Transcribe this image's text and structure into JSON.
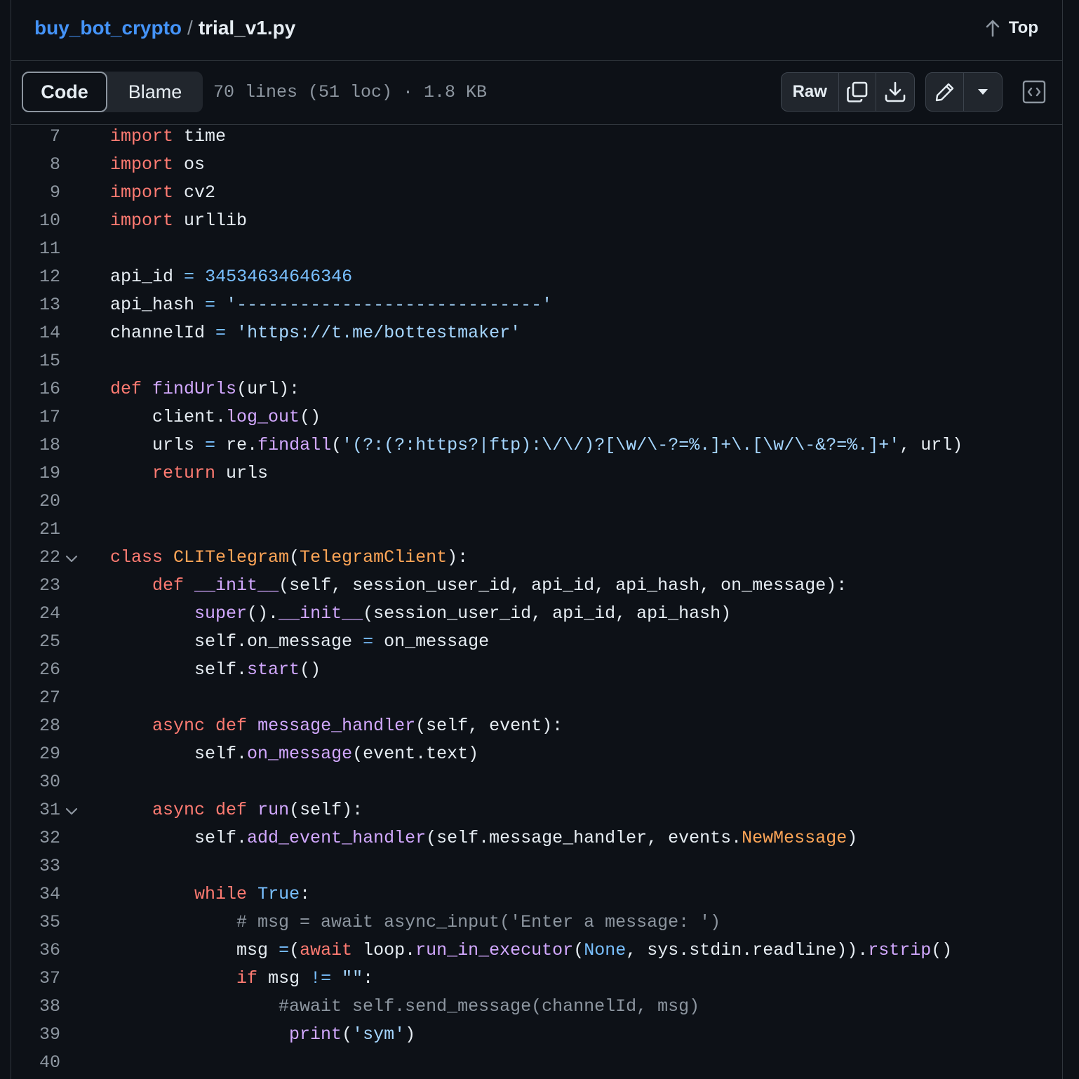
{
  "header": {
    "repo": "buy_bot_crypto",
    "separator": "/",
    "file": "trial_v1.py",
    "top_label": "Top"
  },
  "toolbar": {
    "code_tab": "Code",
    "blame_tab": "Blame",
    "file_meta": "70 lines (51 loc) · 1.8 KB",
    "raw_label": "Raw"
  },
  "lines": [
    {
      "n": "7",
      "fold": false,
      "tokens": [
        [
          "kw",
          "import"
        ],
        [
          "",
          "time"
        ]
      ]
    },
    {
      "n": "8",
      "fold": false,
      "tokens": [
        [
          "kw",
          "import"
        ],
        [
          "",
          "os"
        ]
      ]
    },
    {
      "n": "9",
      "fold": false,
      "tokens": [
        [
          "kw",
          "import"
        ],
        [
          "",
          "cv2"
        ]
      ]
    },
    {
      "n": "10",
      "fold": false,
      "tokens": [
        [
          "kw",
          "import"
        ],
        [
          "",
          "urllib"
        ]
      ]
    },
    {
      "n": "11",
      "fold": false,
      "tokens": []
    },
    {
      "n": "12",
      "fold": false,
      "tokens": [
        [
          "",
          "api_id"
        ],
        [
          "op",
          "="
        ],
        [
          "num",
          "34534634646346"
        ]
      ]
    },
    {
      "n": "13",
      "fold": false,
      "tokens": [
        [
          "",
          "api_hash"
        ],
        [
          "op",
          "="
        ],
        [
          "str",
          "'-----------------------------'"
        ]
      ]
    },
    {
      "n": "14",
      "fold": false,
      "tokens": [
        [
          "",
          "channelId"
        ],
        [
          "op",
          "="
        ],
        [
          "str",
          "'https://t.me/bottestmaker'"
        ]
      ]
    },
    {
      "n": "15",
      "fold": false,
      "tokens": []
    },
    {
      "n": "16",
      "fold": false,
      "tokens": [
        [
          "kw",
          "def"
        ],
        [
          "fn",
          "findUrls"
        ],
        [
          "",
          "(url):"
        ]
      ]
    },
    {
      "n": "17",
      "fold": false,
      "tokens": [
        [
          "",
          "    client."
        ],
        [
          "fn",
          "log_out"
        ],
        [
          "",
          "()"
        ]
      ]
    },
    {
      "n": "18",
      "fold": false,
      "tokens": [
        [
          "",
          "    urls"
        ],
        [
          "op",
          "="
        ],
        [
          "",
          "re."
        ],
        [
          "fn",
          "findall"
        ],
        [
          "",
          "("
        ],
        [
          "str",
          "'(?:(?:https?|ftp):\\/\\/)?[\\w/\\-?=%.]+\\.[\\w/\\-&?=%.]+'"
        ],
        [
          "",
          ", url)"
        ]
      ]
    },
    {
      "n": "19",
      "fold": false,
      "tokens": [
        [
          "kw",
          "    return"
        ],
        [
          "",
          "urls"
        ]
      ]
    },
    {
      "n": "20",
      "fold": false,
      "tokens": []
    },
    {
      "n": "21",
      "fold": false,
      "tokens": []
    },
    {
      "n": "22",
      "fold": true,
      "tokens": [
        [
          "kw",
          "class"
        ],
        [
          "cls",
          "CLITelegram"
        ],
        [
          "",
          "("
        ],
        [
          "cls",
          "TelegramClient"
        ],
        [
          "",
          "):"
        ]
      ]
    },
    {
      "n": "23",
      "fold": false,
      "tokens": [
        [
          "kw",
          "    def"
        ],
        [
          "fn",
          "__init__"
        ],
        [
          "",
          "(self, session_user_id, api_id, api_hash, on_message):"
        ]
      ]
    },
    {
      "n": "24",
      "fold": false,
      "tokens": [
        [
          "fn",
          "        super"
        ],
        [
          "",
          "()."
        ],
        [
          "fn",
          "__init__"
        ],
        [
          "",
          "(session_user_id, api_id, api_hash)"
        ]
      ]
    },
    {
      "n": "25",
      "fold": false,
      "tokens": [
        [
          "",
          "        self.on_message"
        ],
        [
          "op",
          "="
        ],
        [
          "",
          "on_message"
        ]
      ]
    },
    {
      "n": "26",
      "fold": false,
      "tokens": [
        [
          "",
          "        self."
        ],
        [
          "fn",
          "start"
        ],
        [
          "",
          "()"
        ]
      ]
    },
    {
      "n": "27",
      "fold": false,
      "tokens": []
    },
    {
      "n": "28",
      "fold": false,
      "tokens": [
        [
          "kw",
          "    async def"
        ],
        [
          "fn",
          "message_handler"
        ],
        [
          "",
          "(self, event):"
        ]
      ]
    },
    {
      "n": "29",
      "fold": false,
      "tokens": [
        [
          "",
          "        self."
        ],
        [
          "fn",
          "on_message"
        ],
        [
          "",
          "(event.text)"
        ]
      ]
    },
    {
      "n": "30",
      "fold": false,
      "tokens": []
    },
    {
      "n": "31",
      "fold": true,
      "tokens": [
        [
          "kw",
          "    async def"
        ],
        [
          "fn",
          "run"
        ],
        [
          "",
          "(self):"
        ]
      ]
    },
    {
      "n": "32",
      "fold": false,
      "tokens": [
        [
          "",
          "        self."
        ],
        [
          "fn",
          "add_event_handler"
        ],
        [
          "",
          "(self.message_handler, events."
        ],
        [
          "cls",
          "NewMessage"
        ],
        [
          "",
          ")"
        ]
      ]
    },
    {
      "n": "33",
      "fold": false,
      "tokens": []
    },
    {
      "n": "34",
      "fold": false,
      "tokens": [
        [
          "kw",
          "        while"
        ],
        [
          "op",
          "True"
        ],
        [
          "",
          ":"
        ]
      ]
    },
    {
      "n": "35",
      "fold": false,
      "tokens": [
        [
          "cm",
          "            # msg = await async_input('Enter a message: ')"
        ]
      ]
    },
    {
      "n": "36",
      "fold": false,
      "tokens": [
        [
          "",
          "            msg"
        ],
        [
          "op",
          "="
        ],
        [
          "",
          "("
        ],
        [
          "kw",
          "await"
        ],
        [
          "",
          "loop."
        ],
        [
          "fn",
          "run_in_executor"
        ],
        [
          "",
          "("
        ],
        [
          "op",
          "None"
        ],
        [
          "",
          ", sys.stdin.readline))."
        ],
        [
          "fn",
          "rstrip"
        ],
        [
          "",
          "()"
        ]
      ]
    },
    {
      "n": "37",
      "fold": false,
      "tokens": [
        [
          "kw",
          "            if"
        ],
        [
          "",
          "msg"
        ],
        [
          "op",
          "!="
        ],
        [
          "str",
          "\"\""
        ],
        [
          "",
          ":"
        ]
      ]
    },
    {
      "n": "38",
      "fold": false,
      "tokens": [
        [
          "cm",
          "                #await self.send_message(channelId, msg)"
        ]
      ]
    },
    {
      "n": "39",
      "fold": false,
      "tokens": [
        [
          "fn",
          "                 print"
        ],
        [
          "",
          "("
        ],
        [
          "str",
          "'sym'"
        ],
        [
          "",
          ")"
        ]
      ]
    },
    {
      "n": "40",
      "fold": false,
      "tokens": []
    }
  ]
}
